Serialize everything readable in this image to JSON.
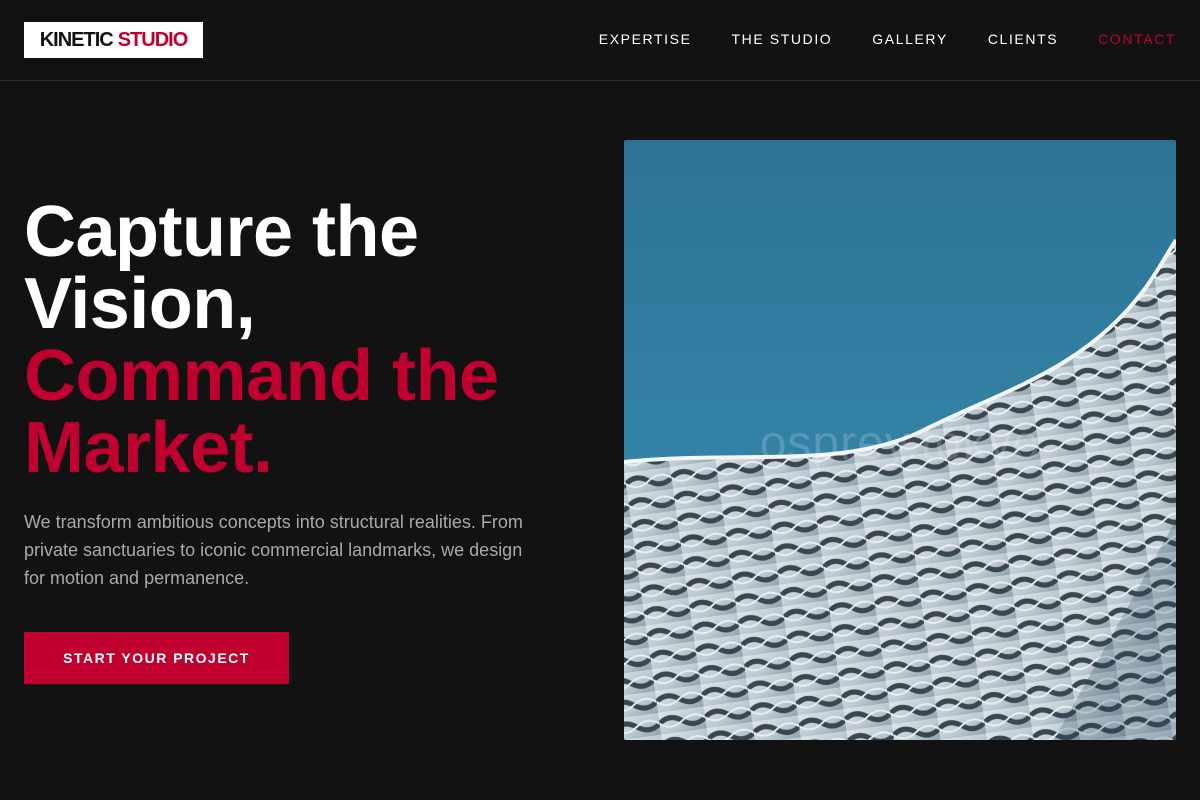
{
  "header": {
    "logo": {
      "word1": "KINETIC",
      "word2": "STUDIO"
    },
    "nav": [
      {
        "label": "EXPERTISE"
      },
      {
        "label": "THE STUDIO"
      },
      {
        "label": "GALLERY"
      },
      {
        "label": "CLIENTS"
      },
      {
        "label": "CONTACT",
        "active": true
      }
    ]
  },
  "hero": {
    "headline_line1": "Capture the",
    "headline_line2": "Vision,",
    "headline_line3": "Command the",
    "headline_line4": "Market.",
    "description": "We transform ambitious concepts into structural realities. From private sanctuaries to iconic commercial landmarks, we design for motion and permanence.",
    "cta_label": "START YOUR PROJECT",
    "image_watermark": "osprey.tokyo"
  },
  "colors": {
    "background": "#121212",
    "accent": "#c0002f",
    "text_primary": "#ffffff",
    "text_muted": "#a9a9a9",
    "sky": "#2f7fa3"
  },
  "icons": {
    "hero_image": "architecture-facade-photo"
  }
}
